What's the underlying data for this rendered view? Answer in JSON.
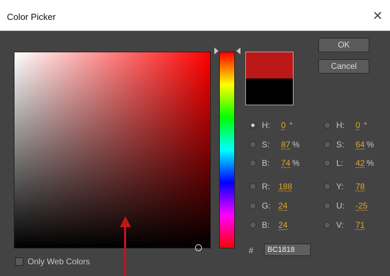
{
  "window": {
    "title": "Color Picker"
  },
  "buttons": {
    "ok": "OK",
    "cancel": "Cancel"
  },
  "colors": {
    "new": "#BC1818",
    "old": "#000000",
    "accent_value": "#e0a62a",
    "annotation_arrow": "#c1151b"
  },
  "fields": {
    "hsb": [
      {
        "label": "H:",
        "value": "0",
        "unit": "°",
        "selected": true
      },
      {
        "label": "S:",
        "value": "87",
        "unit": "%",
        "selected": false
      },
      {
        "label": "B:",
        "value": "74",
        "unit": "%",
        "selected": false
      }
    ],
    "rgb": [
      {
        "label": "R:",
        "value": "188",
        "selected": false
      },
      {
        "label": "G:",
        "value": "24",
        "selected": false
      },
      {
        "label": "B:",
        "value": "24",
        "selected": false
      }
    ],
    "hsl": [
      {
        "label": "H:",
        "value": "0",
        "unit": "°",
        "selected": false
      },
      {
        "label": "S:",
        "value": "64",
        "unit": "%",
        "selected": false
      },
      {
        "label": "L:",
        "value": "42",
        "unit": "%",
        "selected": false
      }
    ],
    "yuv": [
      {
        "label": "Y:",
        "value": "78",
        "selected": false
      },
      {
        "label": "U:",
        "value": "-25",
        "selected": false
      },
      {
        "label": "V:",
        "value": "71",
        "selected": false
      }
    ],
    "hex": {
      "symbol": "#",
      "value": "BC1818"
    }
  },
  "options": {
    "only_web_colors_label": "Only Web Colors",
    "only_web_colors_checked": false
  }
}
